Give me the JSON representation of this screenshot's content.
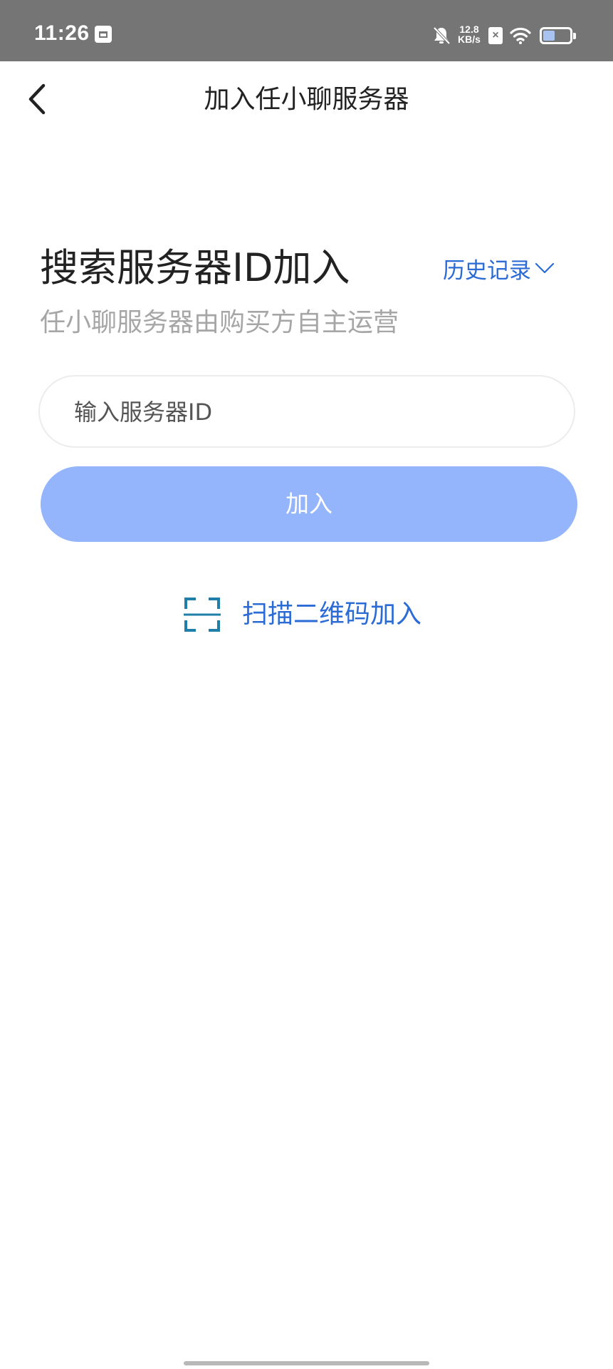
{
  "status_bar": {
    "time": "11:26",
    "net_speed_value": "12.8",
    "net_speed_unit": "KB/s",
    "battery_level": 0.45,
    "icons": [
      "calendar-app-icon",
      "bell-off-icon",
      "sim-x-icon",
      "wifi-icon",
      "battery-icon"
    ]
  },
  "header": {
    "back_icon": "chevron-left-icon",
    "title": "加入任小聊服务器"
  },
  "search": {
    "heading": "搜索服务器ID加入",
    "history_label": "历史记录",
    "history_icon": "chevron-down-icon",
    "subtitle": "任小聊服务器由购买方自主运营",
    "input_placeholder": "输入服务器ID",
    "input_value": ""
  },
  "join_button": {
    "label": "加入",
    "enabled": false
  },
  "scan": {
    "icon": "scan-frame-icon",
    "label": "扫描二维码加入"
  },
  "colors": {
    "status_bar_bg": "#757575",
    "accent": "#2b6bd6",
    "join_button_disabled": "#94b5fb",
    "scan_icon": "#1f7fa8",
    "text_primary": "#222222",
    "text_secondary": "#a6a6a6"
  }
}
